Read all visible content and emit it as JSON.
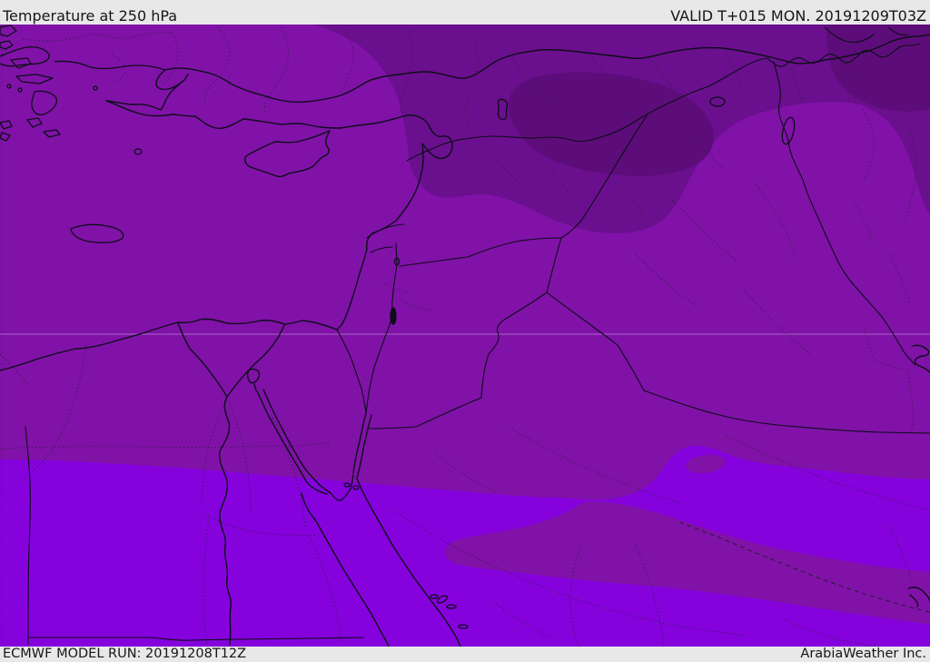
{
  "header": {
    "title": "Temperature at 250 hPa",
    "valid_time": "VALID T+015 MON. 20191209T03Z"
  },
  "footer": {
    "model_run": "ECMWF MODEL RUN: 20191208T12Z",
    "credit": "ArabiaWeather Inc."
  },
  "colors": {
    "bar_bg": "#e8e8e8",
    "bar_text": "#161616",
    "shade_warmest": "#8502dd",
    "shade_mid": "#8012a8",
    "shade_cold": "#6a0f8e",
    "shade_coldest": "#5d0d7a",
    "coastline": "#0d0d18",
    "admin_dotted": "#2b1f38",
    "dashed_boundary": "#241c30",
    "gridline": "#d8cfe0"
  }
}
